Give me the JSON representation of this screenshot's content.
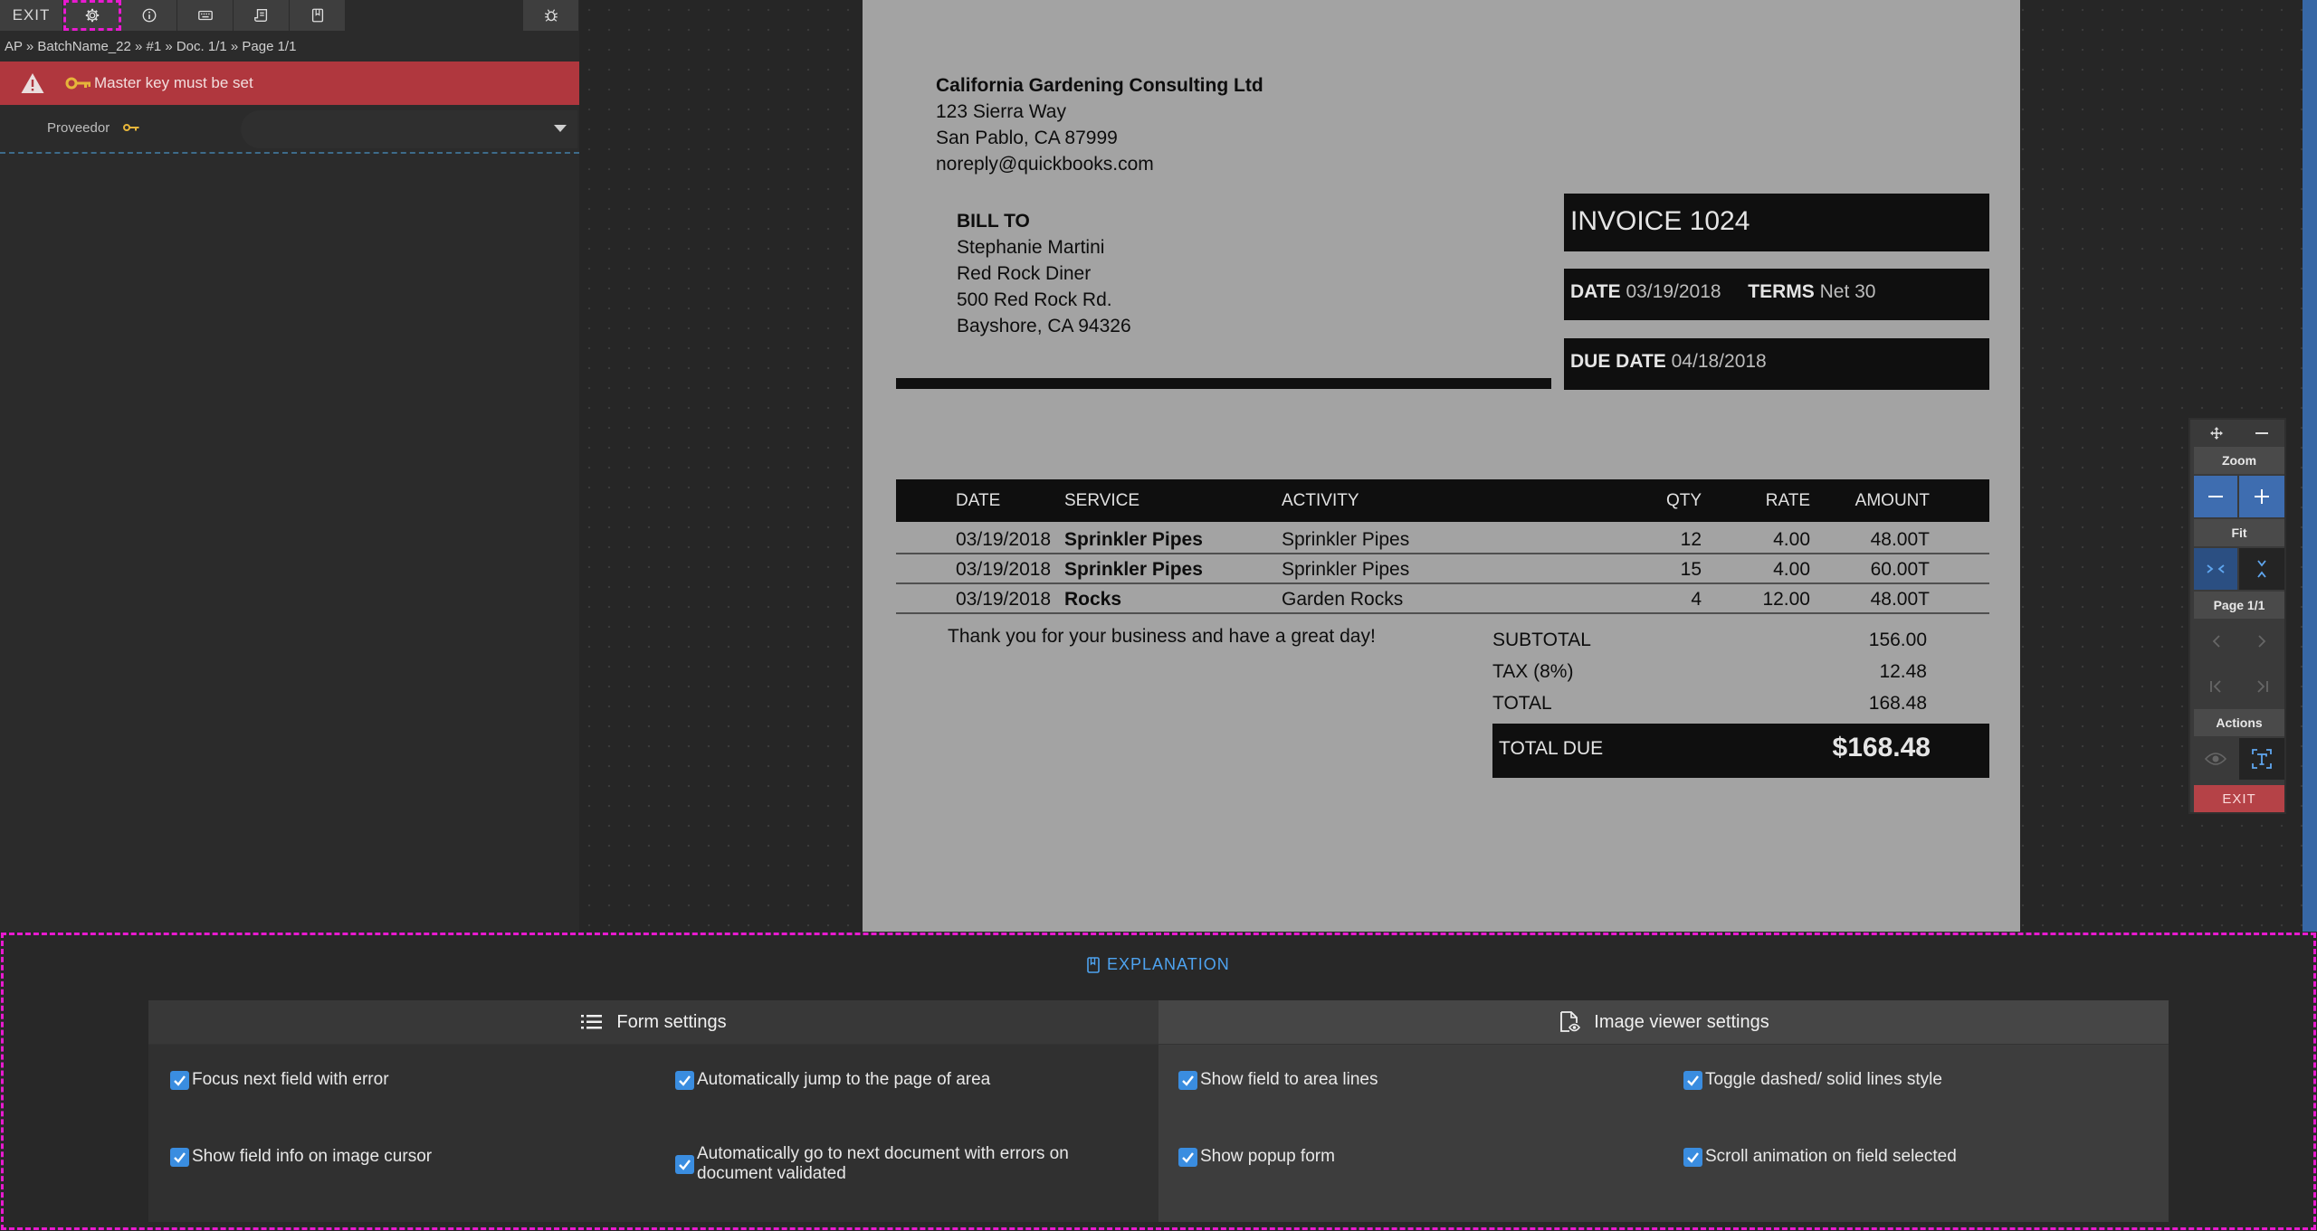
{
  "toolbar": {
    "exit_label": "EXIT",
    "icons": [
      "gear-icon",
      "info-icon",
      "keyboard-icon",
      "scroll-icon",
      "bookmark-icon",
      "bug-icon"
    ]
  },
  "breadcrumb": "AP » BatchName_22 » #1 » Doc. 1/1 » Page 1/1",
  "alert": {
    "text": "Master key must be set"
  },
  "field": {
    "label": "Proveedor",
    "value": ""
  },
  "invoice": {
    "company_name": "California Gardening Consulting Ltd",
    "company_address1": "123 Sierra Way",
    "company_address2": "San Pablo, CA  87999",
    "company_email": "noreply@quickbooks.com",
    "billto_label": "BILL TO",
    "billto_name": "Stephanie Martini",
    "billto_company": "Red Rock Diner",
    "billto_address1": "500 Red Rock Rd.",
    "billto_address2": "Bayshore, CA  94326",
    "invoice_title": "INVOICE 1024",
    "date_label": "DATE",
    "date_value": "03/19/2018",
    "terms_label": "TERMS",
    "terms_value": "Net 30",
    "due_label": "DUE DATE",
    "due_value": "04/18/2018",
    "columns": [
      "DATE",
      "SERVICE",
      "ACTIVITY",
      "QTY",
      "RATE",
      "AMOUNT"
    ],
    "rows": [
      [
        "03/19/2018",
        "Sprinkler Pipes",
        "Sprinkler Pipes",
        "12",
        "4.00",
        "48.00T"
      ],
      [
        "03/19/2018",
        "Sprinkler Pipes",
        "Sprinkler Pipes",
        "15",
        "4.00",
        "60.00T"
      ],
      [
        "03/19/2018",
        "Rocks",
        "Garden Rocks",
        "4",
        "12.00",
        "48.00T"
      ]
    ],
    "thanks": "Thank you for your business and have a great day!",
    "subtotal_label": "SUBTOTAL",
    "subtotal_value": "156.00",
    "tax_label": "TAX (8%)",
    "tax_value": "12.48",
    "total_label": "TOTAL",
    "total_value": "168.48",
    "total_due_label": "TOTAL DUE",
    "total_due_value": "$168.48"
  },
  "controls": {
    "zoom_label": "Zoom",
    "fit_label": "Fit",
    "page_label": "Page 1/1",
    "actions_label": "Actions",
    "exit_label": "EXIT"
  },
  "bottom": {
    "explanation_label": "EXPLANATION",
    "form_settings_title": "Form settings",
    "image_settings_title": "Image viewer settings",
    "options": {
      "focus_next": "Focus next field with error",
      "auto_jump": "Automatically jump to the page of area",
      "show_field_info": "Show field info on image cursor",
      "auto_next_doc": "Automatically go to next document with errors on document validated",
      "show_lines": "Show field to area lines",
      "toggle_dashed": "Toggle dashed/ solid lines style",
      "show_popup": "Show popup form",
      "scroll_anim": "Scroll animation on field selected"
    },
    "checked": true
  }
}
